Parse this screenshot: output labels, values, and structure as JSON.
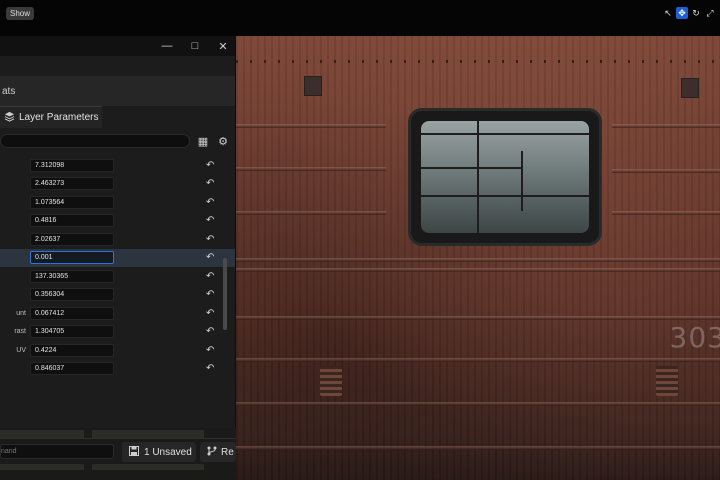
{
  "topbar": {
    "show_label": "Show",
    "tools": [
      "select-icon",
      "translate-icon",
      "rotate-icon",
      "scale-icon"
    ]
  },
  "window_controls": {
    "minimize": "—",
    "maximize": "□",
    "close": "✕"
  },
  "stats_tab": {
    "label": "ats"
  },
  "layer_tab": {
    "label": "Layer Parameters",
    "icon": "layers-icon"
  },
  "parameters": [
    {
      "label": "",
      "value": "7.312098"
    },
    {
      "label": "",
      "value": "2.463273"
    },
    {
      "label": "",
      "value": "1.073564"
    },
    {
      "label": "",
      "value": "0.4816"
    },
    {
      "label": "",
      "value": "2.02637"
    },
    {
      "label": "",
      "value": "0.001",
      "selected": true
    },
    {
      "label": "",
      "value": "137.30365"
    },
    {
      "label": "",
      "value": "0.356304"
    },
    {
      "label": "unt",
      "value": "0.067412"
    },
    {
      "label": "rast",
      "value": "1.304705"
    },
    {
      "label": "UV",
      "value": "0.4224"
    },
    {
      "label": "",
      "value": "0.846037"
    }
  ],
  "bottom": {
    "command_placeholder": "nand",
    "unsaved_label": "1 Unsaved",
    "revision_label": "Re"
  },
  "viewport": {
    "car_number": "303"
  },
  "colors": {
    "accent": "#1f5fd1",
    "panel": "#1c1c1c",
    "train_body": "#6b3a2e"
  }
}
